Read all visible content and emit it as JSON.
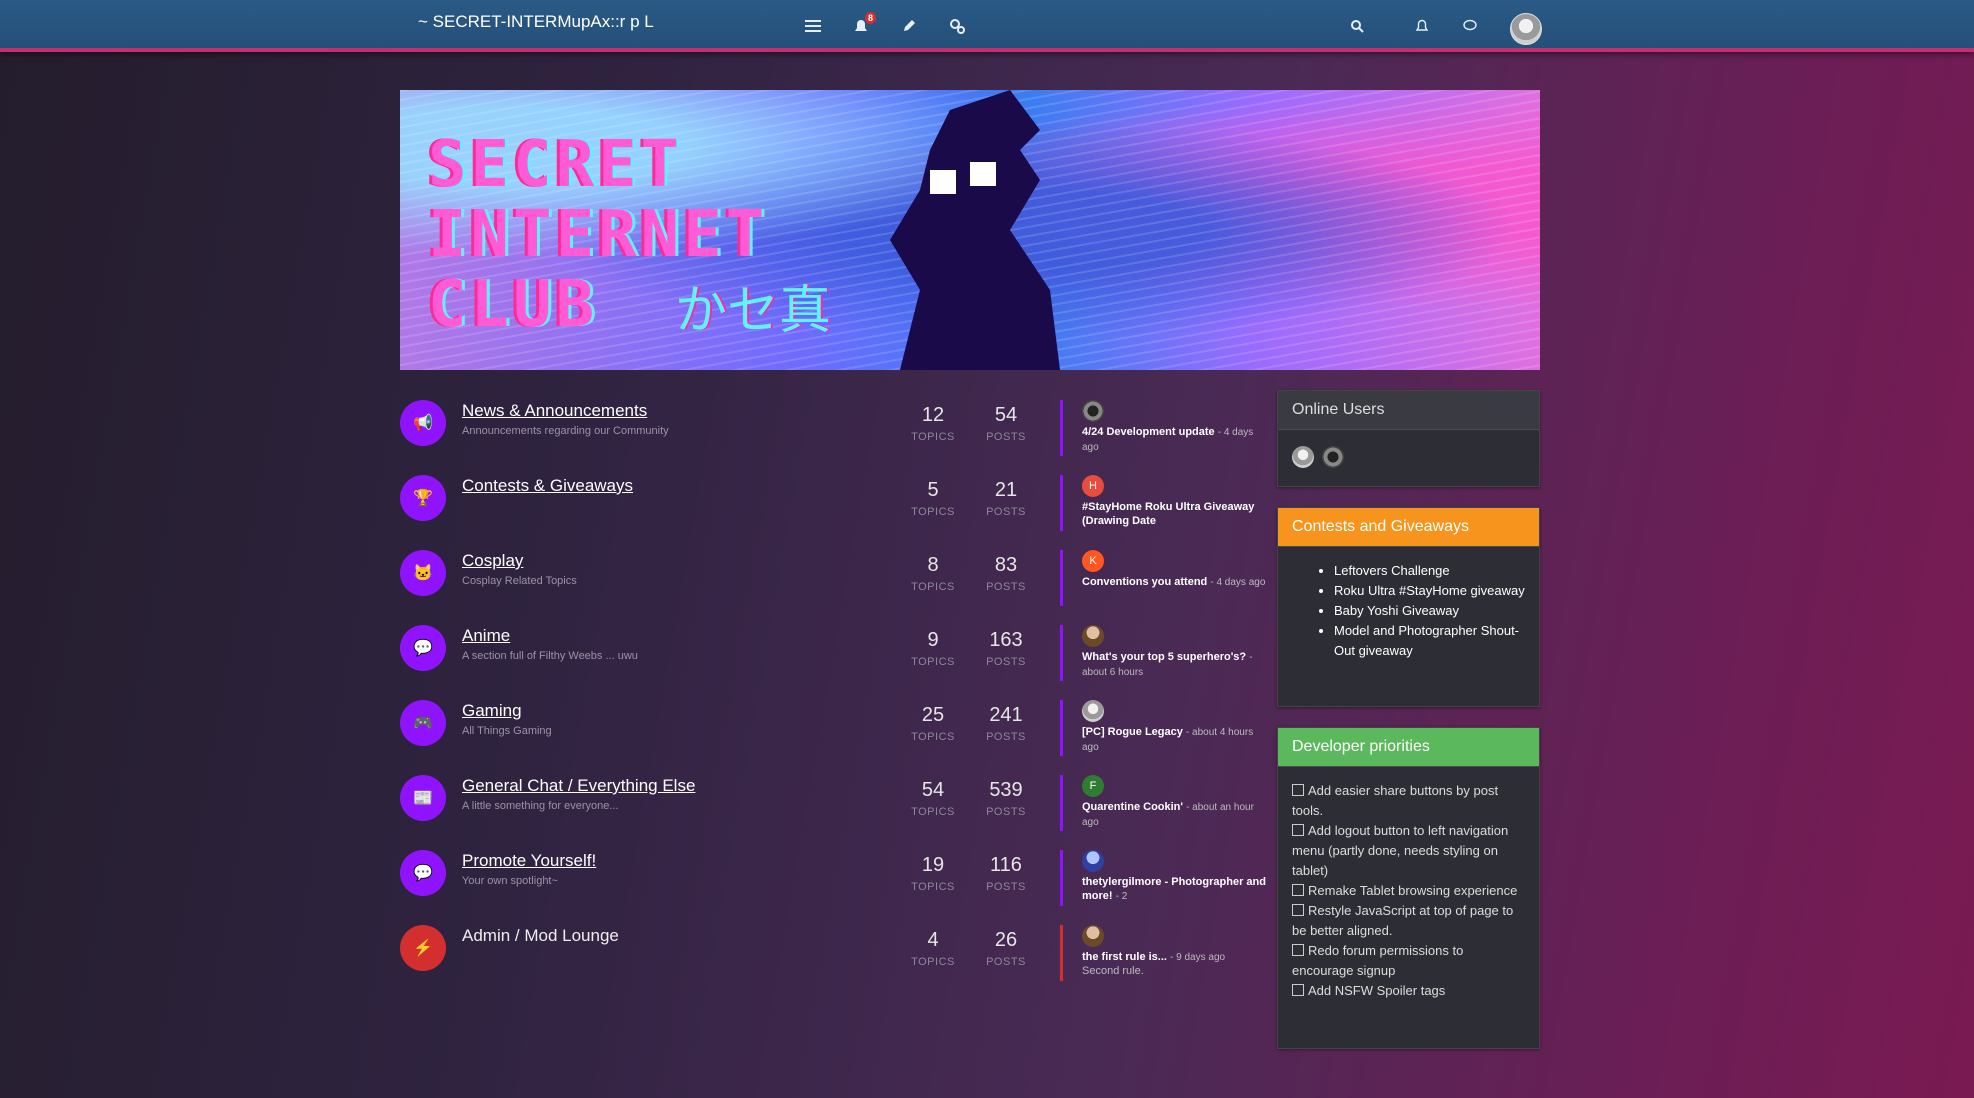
{
  "header": {
    "brand": "~ SECRET-INTERMupAx::r p L",
    "unread_badge": "8",
    "icons": [
      "list-icon",
      "bell-notification-icon",
      "edit-icon",
      "settings-cog-icon",
      "search-icon",
      "bell-icon",
      "chat-icon"
    ]
  },
  "banner": {
    "line1": "SECRET",
    "line2": "INTERNET",
    "line3": "CLUB",
    "jp": "かセ真"
  },
  "categories": [
    {
      "title": "News & Announcements",
      "desc": "Announcements regarding our Community",
      "topics": "12",
      "posts": "54",
      "topics_label": "TOPICS",
      "posts_label": "POSTS",
      "teaser_title": "4/24 Development update",
      "teaser_time": "- 4 days ago",
      "teaser_avatar": ""
    },
    {
      "title": "Contests & Giveaways",
      "desc": "",
      "topics": "5",
      "posts": "21",
      "topics_label": "TOPICS",
      "posts_label": "POSTS",
      "teaser_title": "#StayHome Roku Ultra Giveaway (Drawing Date",
      "teaser_time": "",
      "teaser_avatar": "H"
    },
    {
      "title": "Cosplay",
      "desc": "Cosplay Related Topics",
      "topics": "8",
      "posts": "83",
      "topics_label": "TOPICS",
      "posts_label": "POSTS",
      "teaser_title": "Conventions you attend",
      "teaser_time": "- 4 days ago",
      "teaser_avatar": "K"
    },
    {
      "title": "Anime",
      "desc": "A section full of Filthy Weebs ... uwu",
      "topics": "9",
      "posts": "163",
      "topics_label": "TOPICS",
      "posts_label": "POSTS",
      "teaser_title": "What's your top 5 superhero's?",
      "teaser_time": "- about 6 hours",
      "teaser_avatar": ""
    },
    {
      "title": "Gaming",
      "desc": "All Things Gaming",
      "topics": "25",
      "posts": "241",
      "topics_label": "TOPICS",
      "posts_label": "POSTS",
      "teaser_title": "[PC] Rogue Legacy",
      "teaser_time": "- about 4 hours ago",
      "teaser_avatar": ""
    },
    {
      "title": "General Chat / Everything Else",
      "desc": "A little something for everyone...",
      "topics": "54",
      "posts": "539",
      "topics_label": "TOPICS",
      "posts_label": "POSTS",
      "teaser_title": "Quarentine Cookin'",
      "teaser_time": "- about an hour ago",
      "teaser_avatar": "F"
    },
    {
      "title": "Promote Yourself!",
      "desc": "Your own spotlight~",
      "topics": "19",
      "posts": "116",
      "topics_label": "TOPICS",
      "posts_label": "POSTS",
      "teaser_title": "thetylergilmore - Photographer and more!",
      "teaser_time": "- 2",
      "teaser_avatar": ""
    },
    {
      "title": "Admin / Mod Lounge",
      "desc": "",
      "topics": "4",
      "posts": "26",
      "topics_label": "TOPICS",
      "posts_label": "POSTS",
      "teaser_title": "the first rule is...",
      "teaser_time": "- 9 days ago",
      "teaser_sub": "Second rule.",
      "teaser_avatar": ""
    }
  ],
  "sidebar": {
    "online_title": "Online Users",
    "contests_title": "Contests and Giveaways",
    "contests": [
      "Leftovers Challenge",
      "Roku Ultra #StayHome giveaway",
      "Baby Yoshi Giveaway",
      "Model and Photographer Shout-Out giveaway"
    ],
    "dev_title": "Developer priorities",
    "dev_items": [
      "Add easier share buttons by post tools.",
      "Add logout button to left navigation menu (partly done, needs styling on tablet)",
      "Remake Tablet browsing experience",
      "Restyle JavaScript at top of page to be better aligned.",
      "Redo forum permissions to encourage signup",
      "Add NSFW Spoiler tags"
    ]
  },
  "colors": {
    "accent": "#9013fe",
    "topbar": "#2b5a86",
    "stripe": "#c4306f",
    "orange": "#f7941d",
    "green": "#5cb85c",
    "red": "#d32f2f"
  }
}
